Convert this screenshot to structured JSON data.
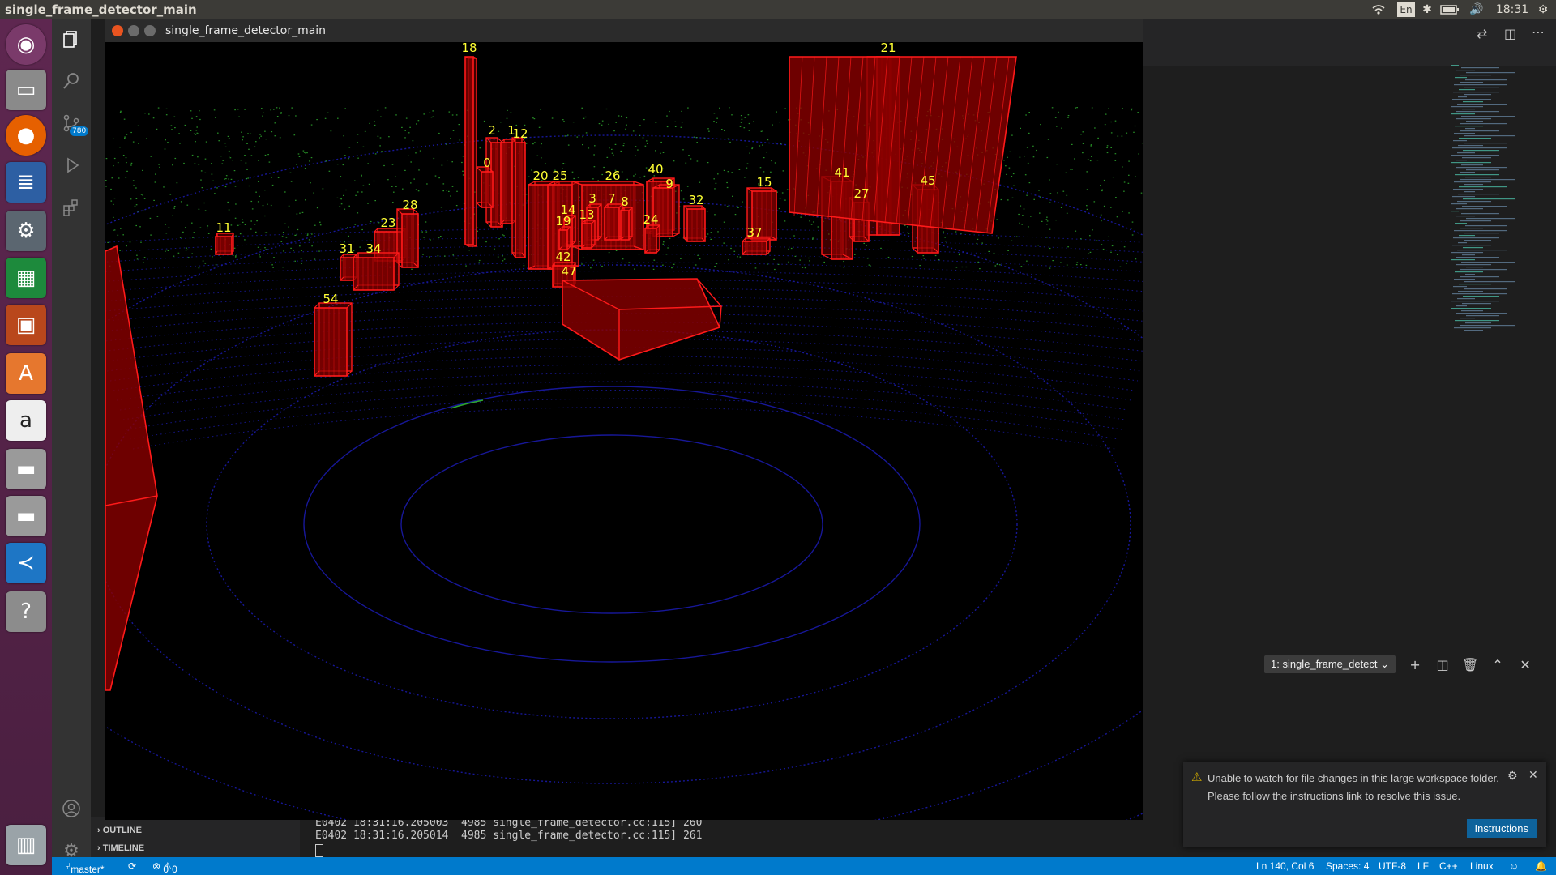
{
  "topbar": {
    "title": "single_frame_detector_main",
    "lang": "En",
    "time": "18:31"
  },
  "vscode": {
    "scm_badge": "780",
    "panel": {
      "outline": "OUTLINE",
      "timeline": "TIMELINE"
    },
    "terminal": {
      "select_label": "1: single_frame_detect",
      "lines": [
        "E0402 18:31:16.205003  4985 single_frame_detector.cc:115] 260",
        "E0402 18:31:16.205014  4985 single_frame_detector.cc:115] 261"
      ]
    },
    "notification": {
      "message": "Unable to watch for file changes in this large workspace folder. Please follow the instructions link to resolve this issue.",
      "button": "Instructions"
    },
    "statusbar": {
      "branch": "master*",
      "problems": "0",
      "warnings": "0",
      "position": "Ln 140, Col 6",
      "spaces": "Spaces: 4",
      "encoding": "UTF-8",
      "eol": "LF",
      "language": "C++",
      "os": "Linux"
    }
  },
  "window": {
    "title": "single_frame_detector_main"
  },
  "detections": [
    "18",
    "21",
    "2",
    "1",
    "12",
    "0",
    "20",
    "25",
    "26",
    "40",
    "9",
    "3",
    "7",
    "8",
    "14",
    "19",
    "13",
    "24",
    "32",
    "15",
    "41",
    "27",
    "45",
    "11",
    "23",
    "28",
    "31",
    "34",
    "37",
    "42",
    "47",
    "54"
  ],
  "colors": {
    "box": "#ff1a1a",
    "box_fill": "#8a0000",
    "label": "#ffff33",
    "ground_points": "#1a1aa8",
    "object_points": "#2ea82e",
    "vscode_status": "#007acc"
  }
}
